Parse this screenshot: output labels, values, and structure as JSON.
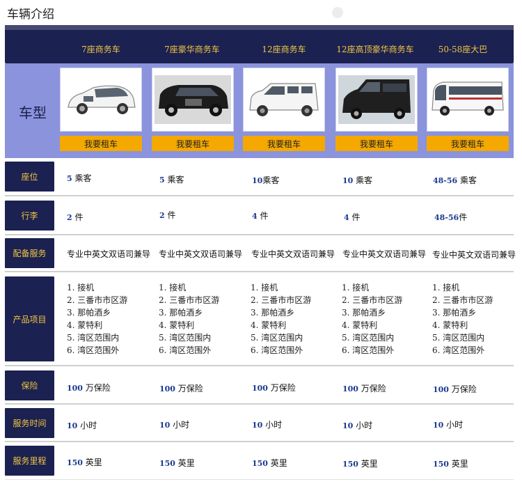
{
  "page_title": "车辆介绍",
  "row_header_image": "车型",
  "cars": [
    {
      "name": "7座商务车",
      "rent": "我要租车",
      "photo_icon": "minivan-icon"
    },
    {
      "name": "7座豪华商务车",
      "rent": "我要租车",
      "photo_icon": "suv-icon"
    },
    {
      "name": "12座商务车",
      "rent": "我要租车",
      "photo_icon": "van-icon"
    },
    {
      "name": "12座高顶豪华商务车",
      "rent": "我要租车",
      "photo_icon": "sprinter-icon"
    },
    {
      "name": "50-58座大巴",
      "rent": "我要租车",
      "photo_icon": "bus-icon"
    }
  ],
  "rows": {
    "seats": {
      "label": "座位",
      "values": [
        {
          "num": "5",
          "unit": "乘客"
        },
        {
          "num": "5",
          "unit": "乘客"
        },
        {
          "num": "10",
          "unit": "乘客"
        },
        {
          "num": "10",
          "unit": "乘客"
        },
        {
          "num": "48-56",
          "unit": "乘客"
        }
      ]
    },
    "luggage": {
      "label": "行李",
      "values": [
        {
          "num": "2",
          "unit": "件"
        },
        {
          "num": "2",
          "unit": "件"
        },
        {
          "num": "4",
          "unit": "件"
        },
        {
          "num": "4",
          "unit": "件"
        },
        {
          "num": "48-56",
          "unit": "件"
        }
      ]
    },
    "service": {
      "label": "配备服务",
      "values": [
        "专业中英文双语司兼导",
        "专业中英文双语司兼导",
        "专业中英文双语司兼导",
        "专业中英文双语司兼导",
        "专业中英文双语司兼导"
      ]
    },
    "products": {
      "label": "产品项目",
      "items": [
        "1. 接机",
        "2. 三番市市区游",
        "3. 那帕酒乡",
        "4. 蒙特利",
        "5. 湾区范围内",
        "6. 湾区范围外"
      ]
    },
    "insurance": {
      "label": "保险",
      "values": [
        {
          "num": "100",
          "unit": "万保险"
        },
        {
          "num": "100",
          "unit": "万保险"
        },
        {
          "num": "100",
          "unit": "万保险"
        },
        {
          "num": "100",
          "unit": "万保险"
        },
        {
          "num": "100",
          "unit": "万保险"
        }
      ]
    },
    "hours": {
      "label": "服务时间",
      "values": [
        {
          "num": "10",
          "unit": "小时"
        },
        {
          "num": "10",
          "unit": "小时"
        },
        {
          "num": "10",
          "unit": "小时"
        },
        {
          "num": "10",
          "unit": "小时"
        },
        {
          "num": "10",
          "unit": "小时"
        }
      ]
    },
    "mileage": {
      "label": "服务里程",
      "values": [
        {
          "num": "150",
          "unit": "英里"
        },
        {
          "num": "150",
          "unit": "英里"
        },
        {
          "num": "150",
          "unit": "英里"
        },
        {
          "num": "150",
          "unit": "英里"
        },
        {
          "num": "150",
          "unit": "英里"
        }
      ]
    }
  },
  "colors": {
    "header": "#1b2150",
    "label_text": "#f2c744",
    "image_band": "#8a93dc",
    "button": "#f4a800",
    "number": "#1b3a8f"
  }
}
